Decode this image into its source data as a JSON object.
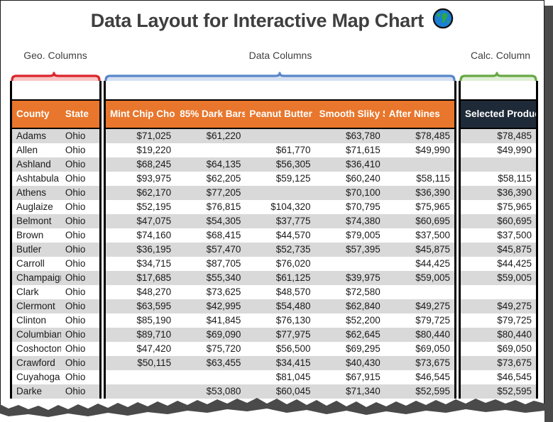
{
  "title": {
    "text": "Data Layout for Interactive Map Chart",
    "icon": "globe-icon"
  },
  "groups": {
    "geo": {
      "label": "Geo. Columns",
      "accent": "#d9262c",
      "fill": "#f8c6c6"
    },
    "data": {
      "label": "Data Columns",
      "accent": "#5a87c9",
      "fill": "#d6e0f2"
    },
    "calc": {
      "label": "Calc. Column",
      "accent": "#68a844",
      "fill": "#e0efd6"
    }
  },
  "colors": {
    "header_orange": "#e8762c",
    "header_dark": "#1f2a38",
    "row_alt": "#d9d9d9",
    "row_base": "#ffffff",
    "title_text": "#3f3f3f"
  },
  "table": {
    "geo_headers": [
      "County",
      "State"
    ],
    "data_headers": [
      "Mint Chip Choc",
      "85% Dark Bars",
      "Peanut Butter C",
      "Smooth Sliky Sa",
      "After Nines"
    ],
    "calc_header": "Selected Product",
    "rows": [
      {
        "county": "Adams",
        "state": "Ohio",
        "values": [
          "$71,025",
          "$61,220",
          "",
          "$63,780",
          "$78,485"
        ],
        "selected": "$78,485"
      },
      {
        "county": "Allen",
        "state": "Ohio",
        "values": [
          "$19,220",
          "",
          "$61,770",
          "$71,615",
          "$49,990"
        ],
        "selected": "$49,990"
      },
      {
        "county": "Ashland",
        "state": "Ohio",
        "values": [
          "$68,245",
          "$64,135",
          "$56,305",
          "$36,410",
          ""
        ],
        "selected": ""
      },
      {
        "county": "Ashtabula",
        "state": "Ohio",
        "values": [
          "$93,975",
          "$62,205",
          "$59,125",
          "$60,240",
          "$58,115"
        ],
        "selected": "$58,115"
      },
      {
        "county": "Athens",
        "state": "Ohio",
        "values": [
          "$62,170",
          "$77,205",
          "",
          "$70,100",
          "$36,390"
        ],
        "selected": "$36,390"
      },
      {
        "county": "Auglaize",
        "state": "Ohio",
        "values": [
          "$52,195",
          "$76,815",
          "$104,320",
          "$70,795",
          "$75,965"
        ],
        "selected": "$75,965"
      },
      {
        "county": "Belmont",
        "state": "Ohio",
        "values": [
          "$47,075",
          "$54,305",
          "$37,775",
          "$74,380",
          "$60,695"
        ],
        "selected": "$60,695"
      },
      {
        "county": "Brown",
        "state": "Ohio",
        "values": [
          "$74,160",
          "$68,415",
          "$44,570",
          "$79,005",
          "$37,500"
        ],
        "selected": "$37,500"
      },
      {
        "county": "Butler",
        "state": "Ohio",
        "values": [
          "$36,195",
          "$57,470",
          "$52,735",
          "$57,395",
          "$45,875"
        ],
        "selected": "$45,875"
      },
      {
        "county": "Carroll",
        "state": "Ohio",
        "values": [
          "$34,715",
          "$87,705",
          "$76,020",
          "",
          "$44,425"
        ],
        "selected": "$44,425"
      },
      {
        "county": "Champaign",
        "state": "Ohio",
        "values": [
          "$17,685",
          "$55,340",
          "$61,125",
          "$39,975",
          "$59,005"
        ],
        "selected": "$59,005"
      },
      {
        "county": "Clark",
        "state": "Ohio",
        "values": [
          "$48,270",
          "$73,625",
          "$48,570",
          "$72,580",
          ""
        ],
        "selected": ""
      },
      {
        "county": "Clermont",
        "state": "Ohio",
        "values": [
          "$63,595",
          "$42,995",
          "$54,480",
          "$62,840",
          "$49,275"
        ],
        "selected": "$49,275"
      },
      {
        "county": "Clinton",
        "state": "Ohio",
        "values": [
          "$85,190",
          "$41,845",
          "$76,130",
          "$52,200",
          "$79,725"
        ],
        "selected": "$79,725"
      },
      {
        "county": "Columbiana",
        "state": "Ohio",
        "values": [
          "$89,710",
          "$69,090",
          "$77,975",
          "$62,645",
          "$80,440"
        ],
        "selected": "$80,440"
      },
      {
        "county": "Coshocton",
        "state": "Ohio",
        "values": [
          "$47,420",
          "$75,720",
          "$56,500",
          "$69,295",
          "$69,050"
        ],
        "selected": "$69,050"
      },
      {
        "county": "Crawford",
        "state": "Ohio",
        "values": [
          "$50,115",
          "$63,455",
          "$34,415",
          "$40,430",
          "$73,675"
        ],
        "selected": "$73,675"
      },
      {
        "county": "Cuyahoga",
        "state": "Ohio",
        "values": [
          "",
          "",
          "$81,045",
          "$67,915",
          "$46,545"
        ],
        "selected": "$46,545"
      },
      {
        "county": "Darke",
        "state": "Ohio",
        "values": [
          "",
          "$53,080",
          "$60,045",
          "$71,340",
          "$52,595"
        ],
        "selected": "$52,595"
      }
    ]
  }
}
